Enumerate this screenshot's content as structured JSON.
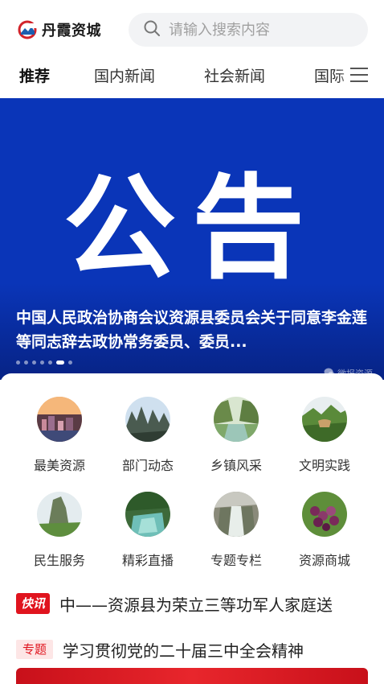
{
  "header": {
    "logo_text": "丹霞资城",
    "search_placeholder": "请输入搜索内容"
  },
  "tabs": [
    {
      "label": "推荐",
      "active": true
    },
    {
      "label": "国内新闻",
      "active": false
    },
    {
      "label": "社会新闻",
      "active": false
    },
    {
      "label": "国际",
      "active": false
    }
  ],
  "banner": {
    "big_text": "公告",
    "caption": "中国人民政治协商会议资源县委员会关于同意李金莲等同志辞去政协常务委员、委员...",
    "watermark": "微报资源",
    "dots": 7,
    "active_dot": 5
  },
  "grid": [
    {
      "label": "最美资源",
      "icon": "city-view-icon"
    },
    {
      "label": "部门动态",
      "icon": "mountain-peaks-icon"
    },
    {
      "label": "乡镇风采",
      "icon": "river-valley-icon"
    },
    {
      "label": "文明实践",
      "icon": "green-hills-icon"
    },
    {
      "label": "民生服务",
      "icon": "rock-peak-icon"
    },
    {
      "label": "精彩直播",
      "icon": "waterfall-stream-icon"
    },
    {
      "label": "专题专栏",
      "icon": "cascade-icon"
    },
    {
      "label": "资源商城",
      "icon": "grapes-icon"
    }
  ],
  "flash_news": {
    "badge": "快讯",
    "text": "中——资源县为荣立三等功军人家庭送"
  },
  "topic_news": {
    "badge": "专题",
    "text": "学习贯彻党的二十届三中全会精神"
  },
  "colors": {
    "banner_blue": "#0a35b8",
    "accent_red": "#e0141e"
  }
}
